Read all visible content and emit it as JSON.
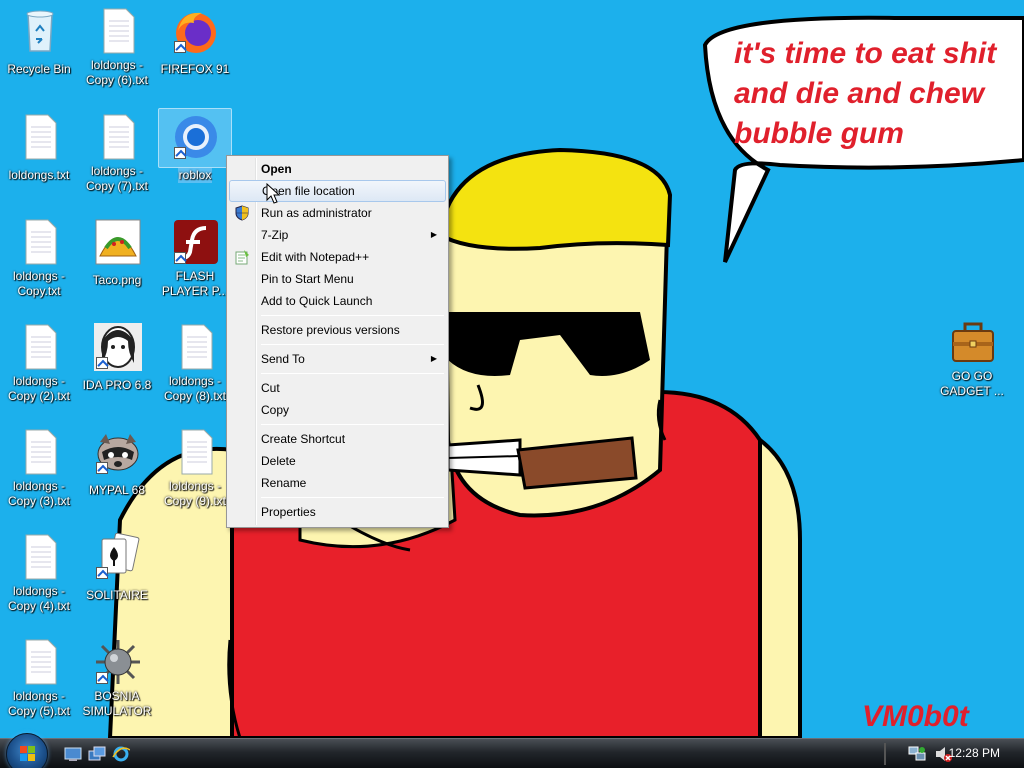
{
  "desktop": {
    "icons": [
      {
        "label": "Recycle Bin",
        "icon": "recycle-bin-icon"
      },
      {
        "label": "loldongs - Copy (6).txt",
        "icon": "text-file-icon"
      },
      {
        "label": "FIREFOX 91",
        "icon": "firefox-icon"
      },
      {
        "label": "loldongs.txt",
        "icon": "text-file-icon"
      },
      {
        "label": "loldongs - Copy (7).txt",
        "icon": "text-file-icon"
      },
      {
        "label": "roblox",
        "icon": "chrome-icon"
      },
      {
        "label": "loldongs - Copy.txt",
        "icon": "text-file-icon"
      },
      {
        "label": "Taco.png",
        "icon": "taco-image-icon"
      },
      {
        "label": "FLASH PLAYER P...",
        "icon": "flash-player-icon"
      },
      {
        "label": "loldongs - Copy (2).txt",
        "icon": "text-file-icon"
      },
      {
        "label": "IDA PRO 6.8",
        "icon": "ida-pro-icon"
      },
      {
        "label": "loldongs - Copy (8).txt",
        "icon": "text-file-icon"
      },
      {
        "label": "loldongs - Copy (3).txt",
        "icon": "text-file-icon"
      },
      {
        "label": "MYPAL 68",
        "icon": "mypal-raccoon-icon"
      },
      {
        "label": "loldongs - Copy (9).txt",
        "icon": "text-file-icon"
      },
      {
        "label": "loldongs - Copy (4).txt",
        "icon": "text-file-icon"
      },
      {
        "label": "SOLITAIRE",
        "icon": "solitaire-cards-icon"
      },
      {
        "label": "loldongs - Copy (5).txt",
        "icon": "text-file-icon"
      },
      {
        "label": "BOSNIA SIMULATOR",
        "icon": "spiked-mine-icon"
      },
      {
        "label": "GO GO GADGET ...",
        "icon": "briefcase-icon"
      }
    ]
  },
  "wallpaper": {
    "speech_lines": [
      "it's time to eat shit",
      "and die and chew",
      "bubble gum"
    ],
    "signature": "VM0b0t"
  },
  "context_menu": {
    "items": [
      {
        "label": "Open",
        "bold": true
      },
      {
        "label": "Open file location",
        "hover": true
      },
      {
        "label": "Run as administrator",
        "icon": "uac-shield-icon"
      },
      {
        "label": "7-Zip",
        "submenu": true
      },
      {
        "label": "Edit with Notepad++",
        "icon": "notepad-plus-plus-icon"
      },
      {
        "label": "Pin to Start Menu"
      },
      {
        "label": "Add to Quick Launch"
      },
      {
        "separator": true
      },
      {
        "label": "Restore previous versions"
      },
      {
        "separator": true
      },
      {
        "label": "Send To",
        "submenu": true
      },
      {
        "separator": true
      },
      {
        "label": "Cut"
      },
      {
        "label": "Copy"
      },
      {
        "separator": true
      },
      {
        "label": "Create Shortcut"
      },
      {
        "label": "Delete"
      },
      {
        "label": "Rename"
      },
      {
        "separator": true
      },
      {
        "label": "Properties"
      }
    ]
  },
  "taskbar": {
    "quick_launch": [
      "show-desktop-icon",
      "switch-windows-icon",
      "internet-explorer-icon"
    ],
    "tray_icons": [
      "network-icon",
      "volume-muted-icon"
    ],
    "clock": "12:28 PM"
  },
  "colors": {
    "desktop_bg": "#1cb0ec",
    "text_red": "#e0202c"
  }
}
